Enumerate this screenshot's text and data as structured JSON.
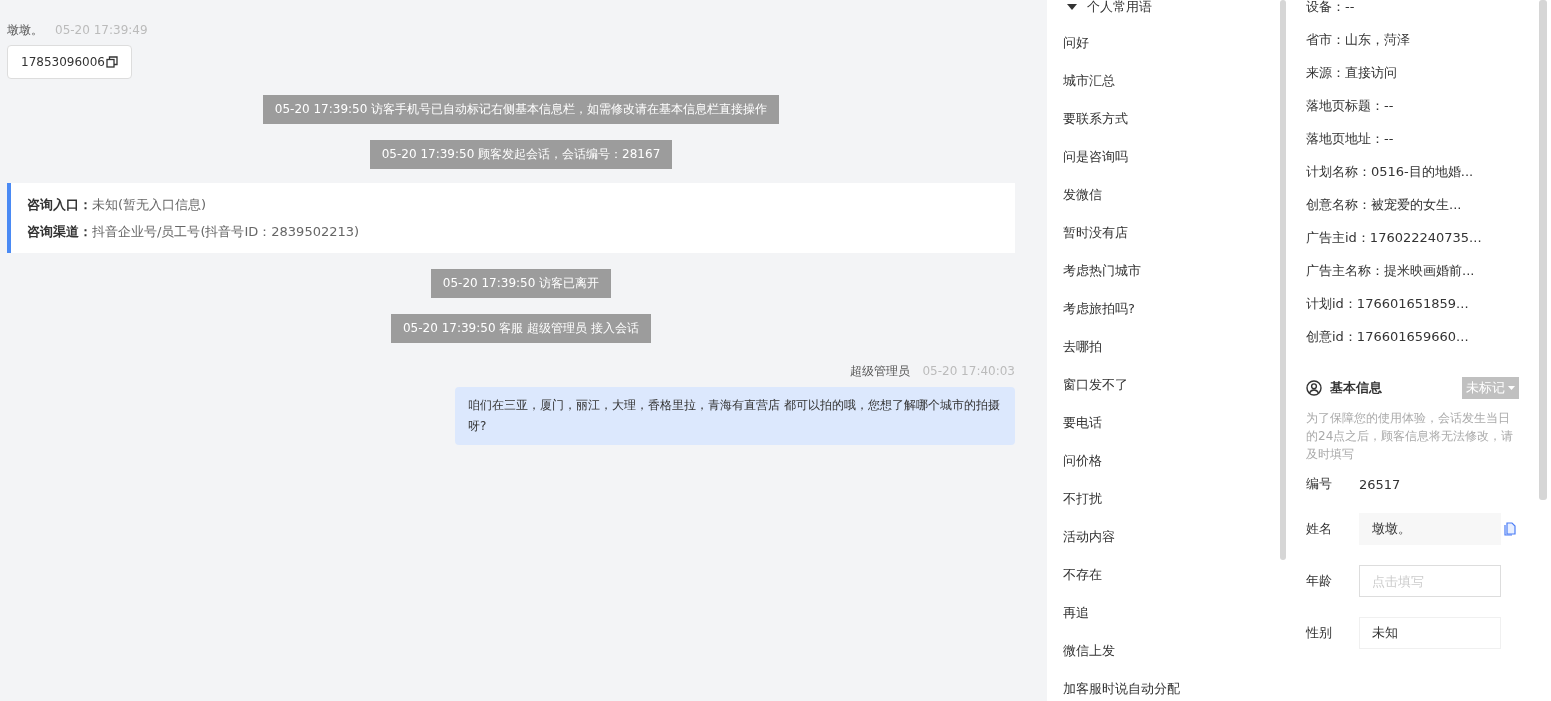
{
  "chat": {
    "messages": [
      {
        "kind": "visitor",
        "sender": "墩墩。",
        "time": "05-20 17:39:49",
        "text": "17853096006"
      },
      {
        "kind": "system",
        "text": "05-20 17:39:50 访客手机号已自动标记右侧基本信息栏，如需修改请在基本信息栏直接操作"
      },
      {
        "kind": "system",
        "text": "05-20 17:39:50 顾客发起会话，会话编号：28167"
      },
      {
        "kind": "info",
        "rows": [
          {
            "label": "咨询入口：",
            "value": "未知(暂无入口信息)"
          },
          {
            "label": "咨询渠道：",
            "value": "抖音企业号/员工号(抖音号ID：2839502213)"
          }
        ]
      },
      {
        "kind": "system",
        "text": "05-20 17:39:50 访客已离开"
      },
      {
        "kind": "system",
        "text": "05-20 17:39:50 客服 超级管理员 接入会话"
      },
      {
        "kind": "agent",
        "sender": "超级管理员",
        "time": "05-20 17:40:03",
        "text": "咱们在三亚，厦门，丽江，大理，香格里拉，青海有直营店 都可以拍的哦，您想了解哪个城市的拍摄呀?"
      }
    ]
  },
  "phrases": {
    "group": "个人常用语",
    "expanded": true,
    "items": [
      "问好",
      "城市汇总",
      "要联系方式",
      "问是咨询吗",
      "发微信",
      "暂时没有店",
      "考虑热门城市",
      "考虑旅拍吗?",
      "去哪拍",
      "窗口发不了",
      "要电话",
      "问价格",
      "不打扰",
      "活动内容",
      "不存在",
      "再追",
      "微信上发",
      "加客服时说自动分配"
    ]
  },
  "visit_info": [
    "设备：--",
    "省市：山东，菏泽",
    "来源：直接访问",
    "落地页标题：--",
    "落地页地址：--",
    "计划名称：0516-目的地婚...",
    "创意名称：被宠爱的女生...",
    "广告主id：176022240735...",
    "广告主名称：提米映画婚前...",
    "计划id：176601651859...",
    "创意id：176601659660..."
  ],
  "basic_info": {
    "title": "基本信息",
    "tag": "未标记",
    "notice": "为了保障您的使用体验，会话发生当日的24点之后，顾客信息将无法修改，请及时填写",
    "fields": [
      {
        "kind": "text",
        "label": "编号",
        "value": "26517"
      },
      {
        "kind": "readonly",
        "label": "姓名",
        "value": "墩墩。"
      },
      {
        "kind": "input",
        "label": "年龄",
        "placeholder": "点击填写"
      },
      {
        "kind": "input",
        "label": "性别",
        "value": "未知"
      }
    ]
  }
}
